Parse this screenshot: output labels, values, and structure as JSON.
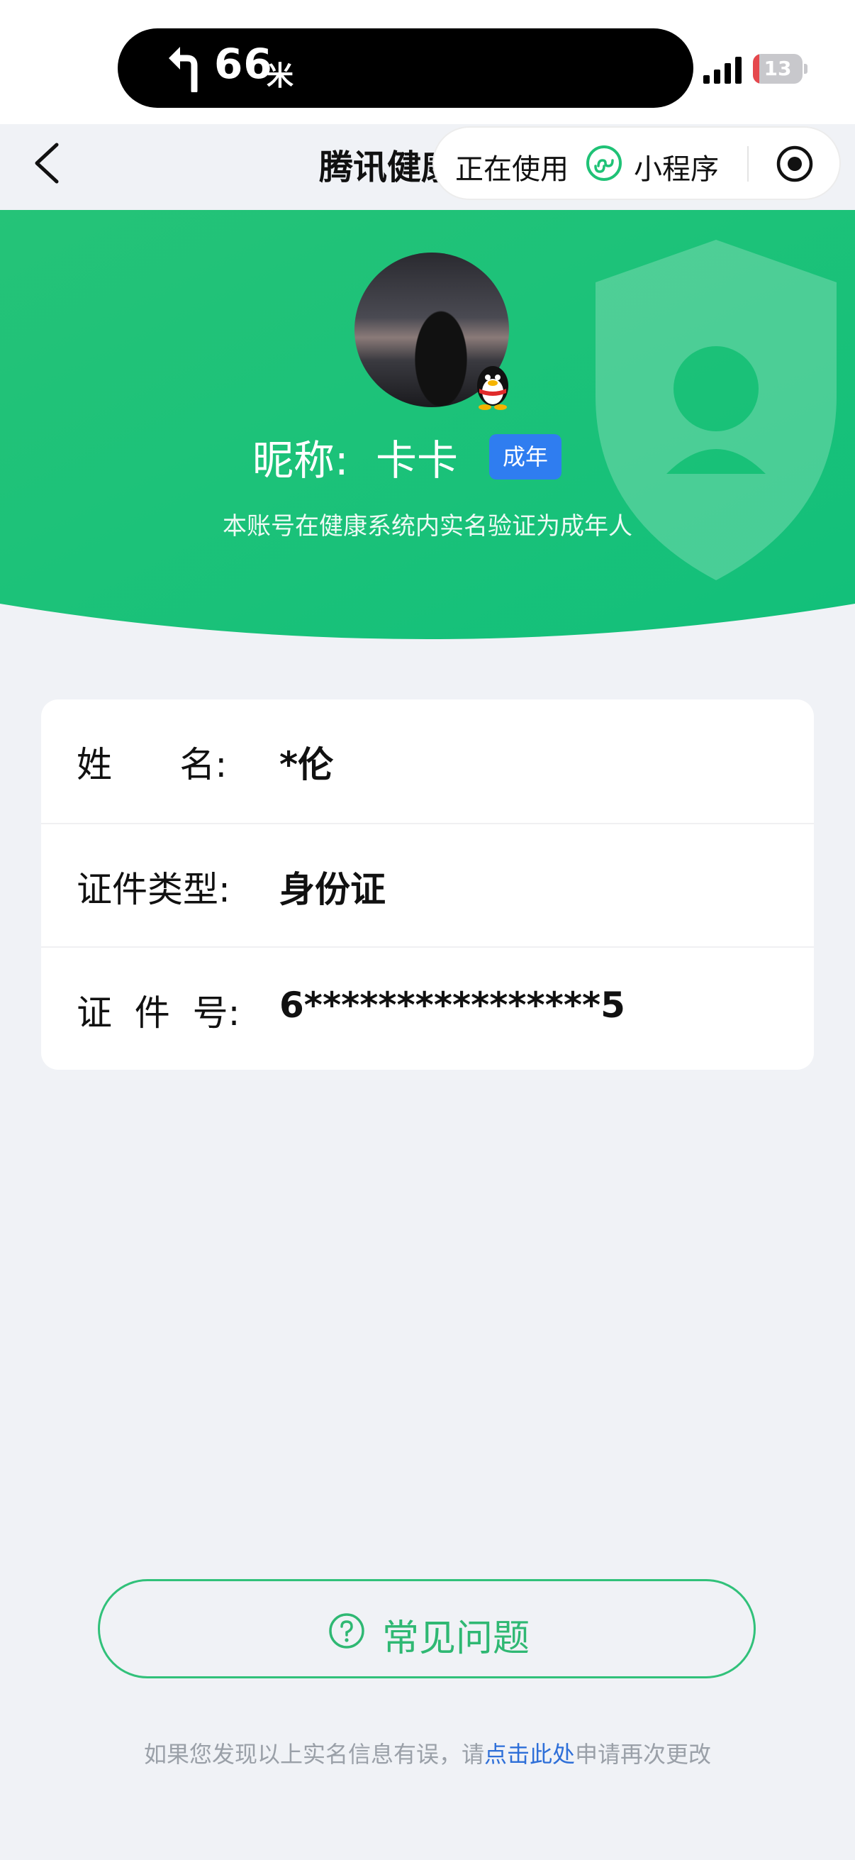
{
  "status_bar": {
    "nav_distance": "66",
    "nav_unit": "米",
    "battery_level": "13",
    "battery_fraction": 0.13,
    "battery_color": "#e5484d"
  },
  "nav": {
    "title": "腾讯健康",
    "capsule_status": "正在使用",
    "capsule_label": "小程序"
  },
  "profile": {
    "nickname_label": "昵称:",
    "nickname": "卡卡",
    "badge": "成年",
    "verify_note": "本账号在健康系统内实名验证为成年人"
  },
  "identity": {
    "rows": [
      {
        "label": "姓      名:",
        "value": "*伦"
      },
      {
        "label": "证件类型:",
        "value": "身份证"
      },
      {
        "label": "证  件  号:",
        "value": "6****************5"
      }
    ]
  },
  "faq": {
    "label": "常见问题"
  },
  "footer": {
    "prefix": "如果您发现以上实名信息有误，请",
    "link": "点击此处",
    "suffix": "申请再次更改"
  },
  "colors": {
    "brand_green": "#1fc276",
    "faq_green": "#2fb873",
    "badge_blue": "#2f7df0",
    "link_blue": "#2e6fd8",
    "background": "#f0f2f6"
  }
}
